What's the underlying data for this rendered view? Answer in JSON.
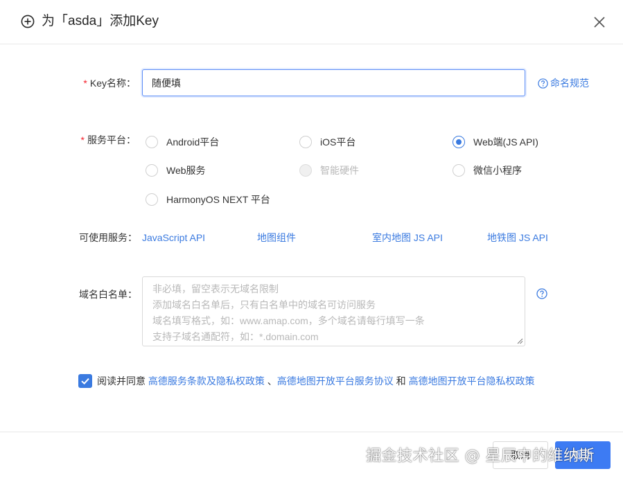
{
  "dialog": {
    "title": "为「asda」添加Key"
  },
  "form": {
    "key_name": {
      "label": "Key名称：",
      "required_mark": "*",
      "value": "随便填",
      "help_link": "命名规范"
    },
    "platform": {
      "label": "服务平台：",
      "required_mark": "*",
      "options": [
        {
          "label": "Android平台",
          "checked": false,
          "disabled": false
        },
        {
          "label": "iOS平台",
          "checked": false,
          "disabled": false
        },
        {
          "label": "Web端(JS API)",
          "checked": true,
          "disabled": false
        },
        {
          "label": "Web服务",
          "checked": false,
          "disabled": false
        },
        {
          "label": "智能硬件",
          "checked": false,
          "disabled": true
        },
        {
          "label": "微信小程序",
          "checked": false,
          "disabled": false
        },
        {
          "label": "HarmonyOS NEXT 平台",
          "checked": false,
          "disabled": false
        }
      ]
    },
    "services": {
      "label": "可使用服务：",
      "items": [
        "JavaScript API",
        "地图组件",
        "室内地图 JS API",
        "地铁图 JS API"
      ]
    },
    "domain": {
      "label": "域名白名单：",
      "placeholder_lines": [
        "非必填，留空表示无域名限制",
        "添加域名白名单后，只有白名单中的域名可访问服务",
        "域名填写格式，如：www.amap.com，多个域名请每行填写一条",
        "支持子域名通配符，如：*.domain.com"
      ]
    },
    "agreement": {
      "checked": true,
      "prefix": "阅读并同意 ",
      "link1": "高德服务条款及隐私权政策",
      "sep1": " 、",
      "link2": "高德地图开放平台服务协议",
      "sep2": " 和 ",
      "link3": "高德地图开放平台隐私权政策"
    }
  },
  "footer": {
    "cancel_label": "取消",
    "submit_label": "提交"
  },
  "watermark": "掘金技术社区 @ 星辰中的维纳斯",
  "colors": {
    "accent": "#3a7ae0",
    "primary_button": "#3d7bf3",
    "required": "#f5222d"
  }
}
